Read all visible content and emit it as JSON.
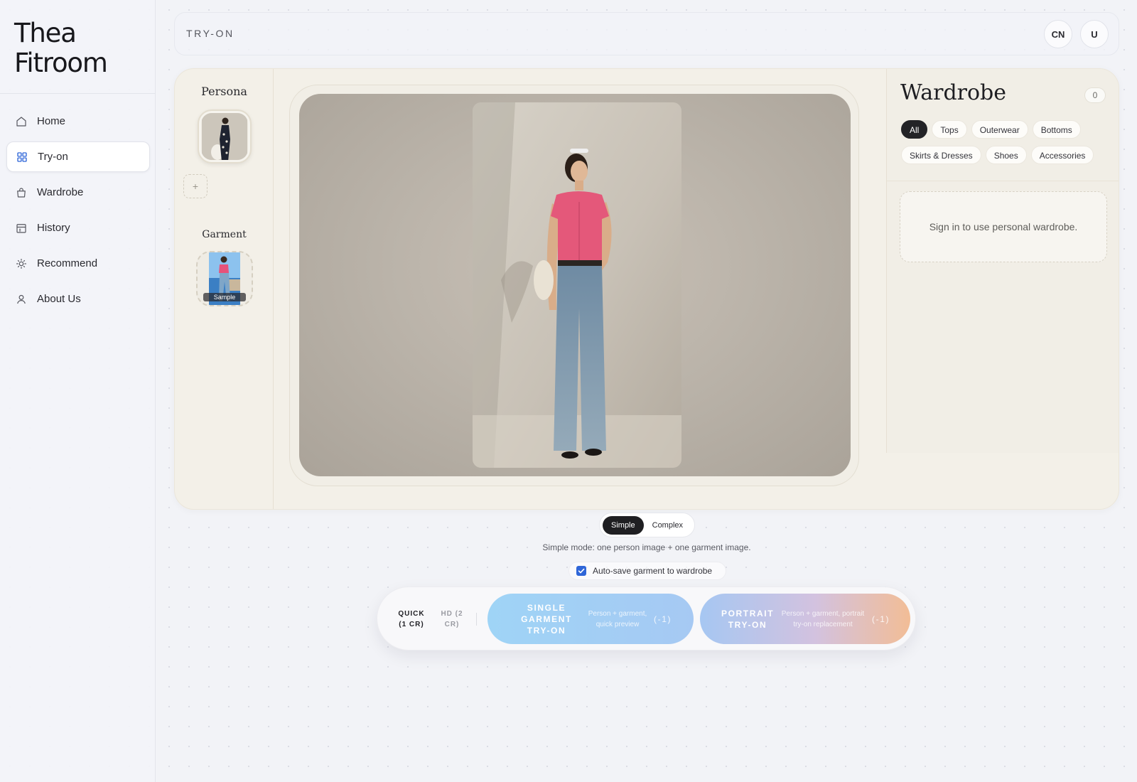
{
  "brand": {
    "title": "Thea Fitroom"
  },
  "sidebar": {
    "items": [
      {
        "label": "Home",
        "icon": "home-icon"
      },
      {
        "label": "Try-on",
        "icon": "grid-icon"
      },
      {
        "label": "Wardrobe",
        "icon": "bag-icon"
      },
      {
        "label": "History",
        "icon": "calendar-icon"
      },
      {
        "label": "Recommend",
        "icon": "sun-icon"
      },
      {
        "label": "About Us",
        "icon": "user-icon"
      }
    ],
    "active_index": 1
  },
  "header": {
    "title": "TRY-ON",
    "language_button": "CN",
    "user_button": "U"
  },
  "left_panel": {
    "persona_heading": "Persona",
    "add_label": "+",
    "garment_heading": "Garment",
    "sample_badge": "Sample"
  },
  "wardrobe": {
    "title": "Wardrobe",
    "count": "0",
    "categories": [
      "All",
      "Tops",
      "Outerwear",
      "Bottoms",
      "Skirts & Dresses",
      "Shoes",
      "Accessories"
    ],
    "active_category": "All",
    "empty_message": "Sign in to use personal wardrobe."
  },
  "mode": {
    "options": [
      "Simple",
      "Complex"
    ],
    "active": "Simple",
    "hint": "Simple mode: one person image + one garment image."
  },
  "autosave": {
    "label": "Auto-save garment to wardrobe",
    "checked": true
  },
  "actions": {
    "quality_quick": "QUICK (1 CR)",
    "quality_hd": "HD (2 CR)",
    "single": {
      "label": "SINGLE GARMENT TRY-ON",
      "sub": "Person + garment, quick preview",
      "cost": "(-1)"
    },
    "portrait": {
      "label": "PORTRAIT TRY-ON",
      "sub": "Person + garment, portrait try-on replacement",
      "cost": "(-1)"
    }
  },
  "colors": {
    "accent_blue": "#2f66d8",
    "dark_chip": "#232326",
    "panel_beige": "#f3f0e8",
    "single_button": "#9fd4f6",
    "portrait_button_end": "#f2bd96"
  }
}
